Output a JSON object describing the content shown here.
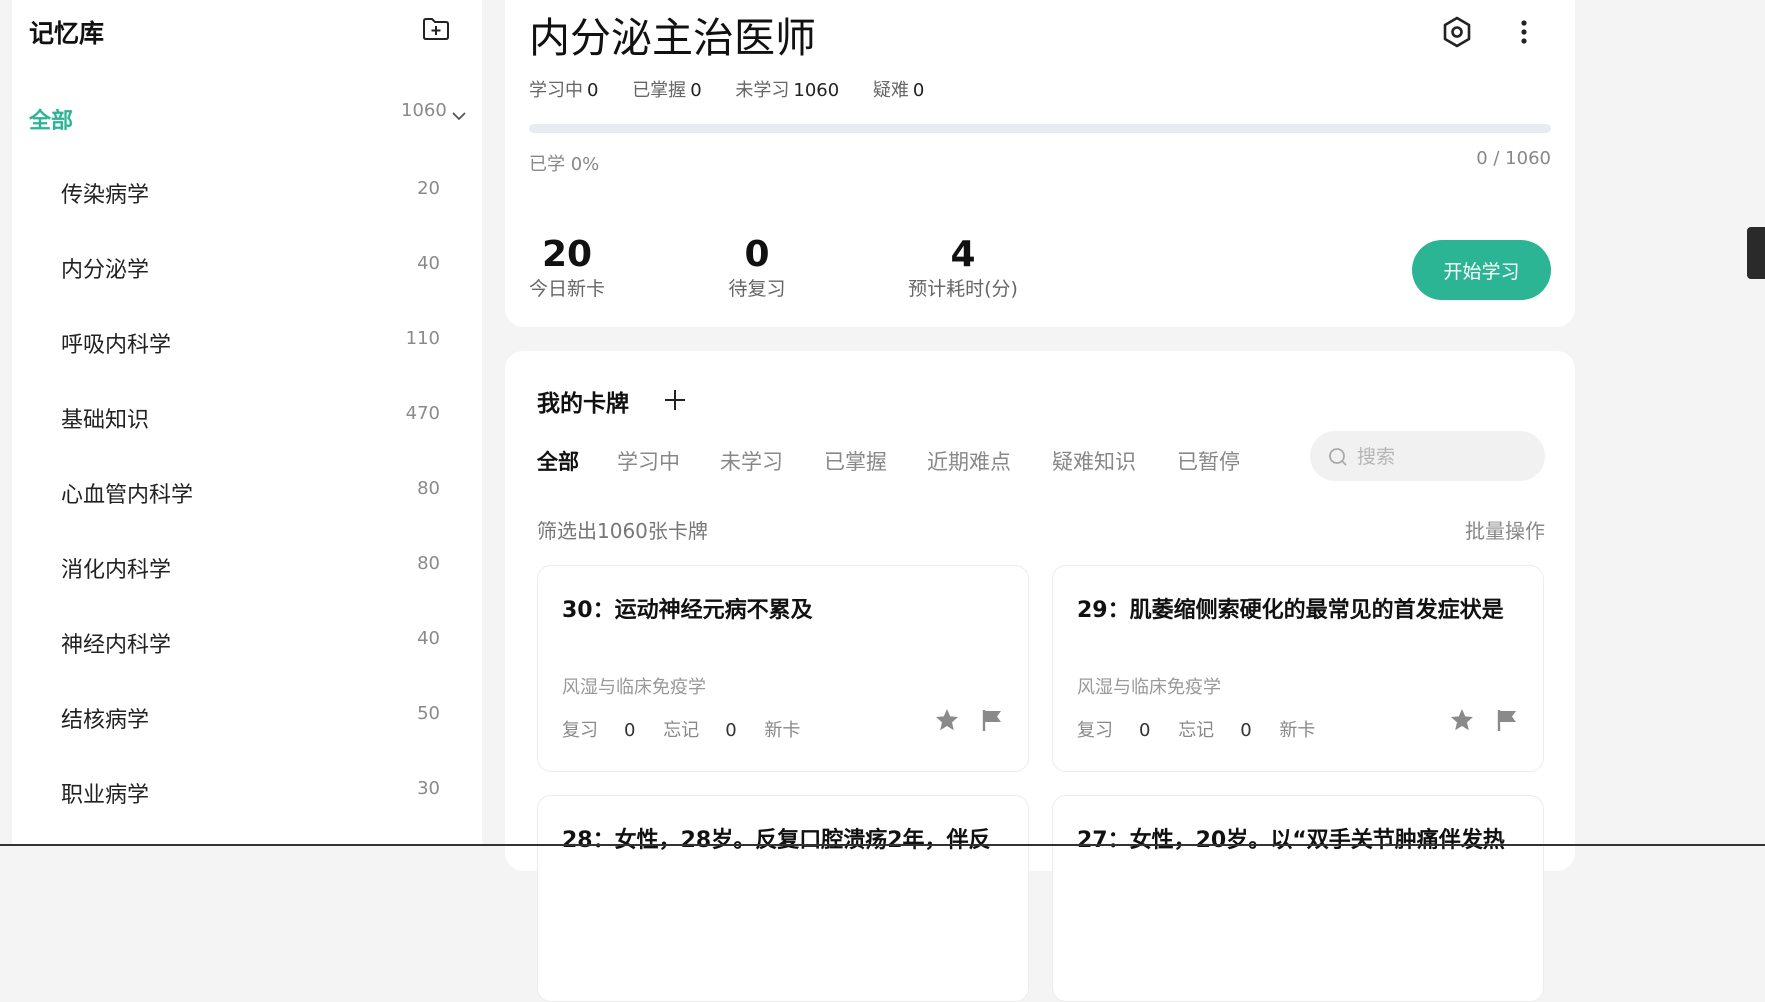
{
  "sidebar": {
    "title": "记忆库",
    "all": {
      "label": "全部",
      "count": "1060"
    },
    "items": [
      {
        "label": "传染病学",
        "count": "20"
      },
      {
        "label": "内分泌学",
        "count": "40"
      },
      {
        "label": "呼吸内科学",
        "count": "110"
      },
      {
        "label": "基础知识",
        "count": "470"
      },
      {
        "label": "心血管内科学",
        "count": "80"
      },
      {
        "label": "消化内科学",
        "count": "80"
      },
      {
        "label": "神经内科学",
        "count": "40"
      },
      {
        "label": "结核病学",
        "count": "50"
      },
      {
        "label": "职业病学",
        "count": "30"
      }
    ]
  },
  "deck": {
    "title": "内分泌主治医师",
    "stats": [
      {
        "label": "学习中",
        "value": "0"
      },
      {
        "label": "已掌握",
        "value": "0"
      },
      {
        "label": "未学习",
        "value": "1060"
      },
      {
        "label": "疑难",
        "value": "0"
      }
    ],
    "progress_fraction": 0,
    "progress_label": "已学 0%",
    "progress_count": "0 / 1060",
    "today_new": {
      "value": "20",
      "label": "今日新卡"
    },
    "to_review": {
      "value": "0",
      "label": "待复习"
    },
    "est_time": {
      "value": "4",
      "label": "预计耗时(分)"
    },
    "start_label": "开始学习"
  },
  "cards_panel": {
    "title": "我的卡牌",
    "tabs": [
      "全部",
      "学习中",
      "未学习",
      "已掌握",
      "近期难点",
      "疑难知识",
      "已暂停"
    ],
    "search_placeholder": "搜索",
    "filter_text": "筛选出1060张卡牌",
    "batch_label": "批量操作",
    "cards": [
      {
        "title": "30：运动神经元病不累及",
        "category": "风湿与临床免疫学",
        "review_label": "复习",
        "review": "0",
        "forget_label": "忘记",
        "forget": "0",
        "status": "新卡"
      },
      {
        "title": "29：肌萎缩侧索硬化的最常见的首发症状是",
        "category": "风湿与临床免疫学",
        "review_label": "复习",
        "review": "0",
        "forget_label": "忘记",
        "forget": "0",
        "status": "新卡"
      },
      {
        "title": "28：女性，28岁。反复口腔溃疡2年，伴反",
        "category": "",
        "review_label": "",
        "review": "",
        "forget_label": "",
        "forget": "",
        "status": ""
      },
      {
        "title": "27：女性，20岁。以“双手关节肿痛伴发热",
        "category": "",
        "review_label": "",
        "review": "",
        "forget_label": "",
        "forget": "",
        "status": ""
      }
    ]
  },
  "colors": {
    "accent": "#2bb594",
    "background": "#f4f4f4"
  },
  "icons": [
    "add-deck-icon",
    "chevron-down-icon",
    "eye-settings-icon",
    "more-vertical-icon",
    "plus-icon",
    "search-icon",
    "star-icon",
    "flag-icon"
  ]
}
